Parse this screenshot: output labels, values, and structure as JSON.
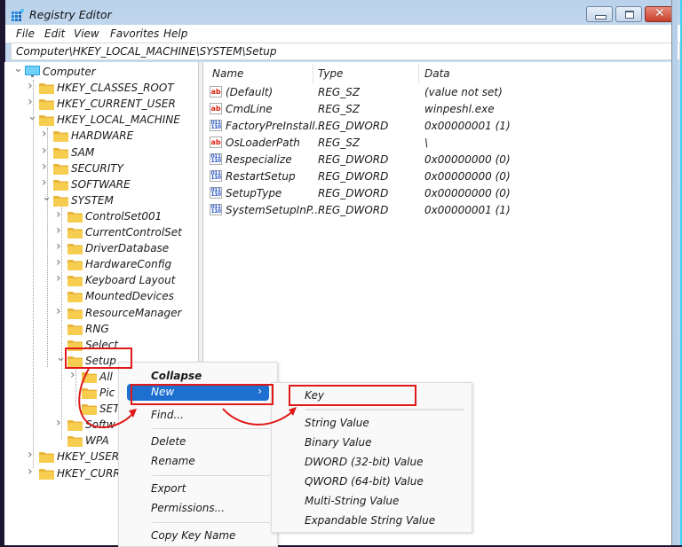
{
  "window": {
    "title": "Registry Editor",
    "controls": {
      "minimize": "minimize",
      "maximize": "maximize",
      "close": "close"
    }
  },
  "menubar": {
    "items": [
      "File",
      "Edit",
      "View",
      "Favorites",
      "Help"
    ]
  },
  "address": {
    "path": "Computer\\HKEY_LOCAL_MACHINE\\SYSTEM\\Setup"
  },
  "tree": {
    "root": "Computer",
    "hives": {
      "classes_root": "HKEY_CLASSES_ROOT",
      "current_user": "HKEY_CURRENT_USER",
      "local_machine": "HKEY_LOCAL_MACHINE",
      "users": "HKEY_USERS",
      "current_config": "HKEY_CURR"
    },
    "hklm_children": [
      "HARDWARE",
      "SAM",
      "SECURITY",
      "SOFTWARE",
      "SYSTEM"
    ],
    "system_children": [
      "ControlSet001",
      "CurrentControlSet",
      "DriverDatabase",
      "HardwareConfig",
      "Keyboard Layout",
      "MountedDevices",
      "ResourceManager",
      "RNG",
      "Select",
      "Setup"
    ],
    "setup_children": [
      "All",
      "Pic",
      "SET"
    ],
    "after_setup": [
      "Softw",
      "WPA"
    ],
    "selected": "Setup"
  },
  "list": {
    "columns": {
      "name": "Name",
      "type": "Type",
      "data": "Data"
    },
    "rows": [
      {
        "icon": "string-value-icon",
        "name": "(Default)",
        "type": "REG_SZ",
        "data": "(value not set)"
      },
      {
        "icon": "string-value-icon",
        "name": "CmdLine",
        "type": "REG_SZ",
        "data": "winpeshl.exe"
      },
      {
        "icon": "dword-value-icon",
        "name": "FactoryPreInstall...",
        "type": "REG_DWORD",
        "data": "0x00000001 (1)"
      },
      {
        "icon": "string-value-icon",
        "name": "OsLoaderPath",
        "type": "REG_SZ",
        "data": "\\"
      },
      {
        "icon": "dword-value-icon",
        "name": "Respecialize",
        "type": "REG_DWORD",
        "data": "0x00000000 (0)"
      },
      {
        "icon": "dword-value-icon",
        "name": "RestartSetup",
        "type": "REG_DWORD",
        "data": "0x00000000 (0)"
      },
      {
        "icon": "dword-value-icon",
        "name": "SetupType",
        "type": "REG_DWORD",
        "data": "0x00000000 (0)"
      },
      {
        "icon": "dword-value-icon",
        "name": "SystemSetupInP...",
        "type": "REG_DWORD",
        "data": "0x00000001 (1)"
      }
    ]
  },
  "context_menu": {
    "collapse": "Collapse",
    "new": "New",
    "find": "Find...",
    "delete": "Delete",
    "rename": "Rename",
    "export": "Export",
    "permissions": "Permissions...",
    "copy_key_name": "Copy Key Name",
    "highlighted": "New"
  },
  "submenu": {
    "items": [
      "Key",
      "String Value",
      "Binary Value",
      "DWORD (32-bit) Value",
      "QWORD (64-bit) Value",
      "Multi-String Value",
      "Expandable String Value"
    ]
  },
  "annotations": {
    "color": "#e01818"
  },
  "colors": {
    "accent": "#1d6fd0",
    "selection": "#cce4f7",
    "folder": "#f3c542"
  }
}
